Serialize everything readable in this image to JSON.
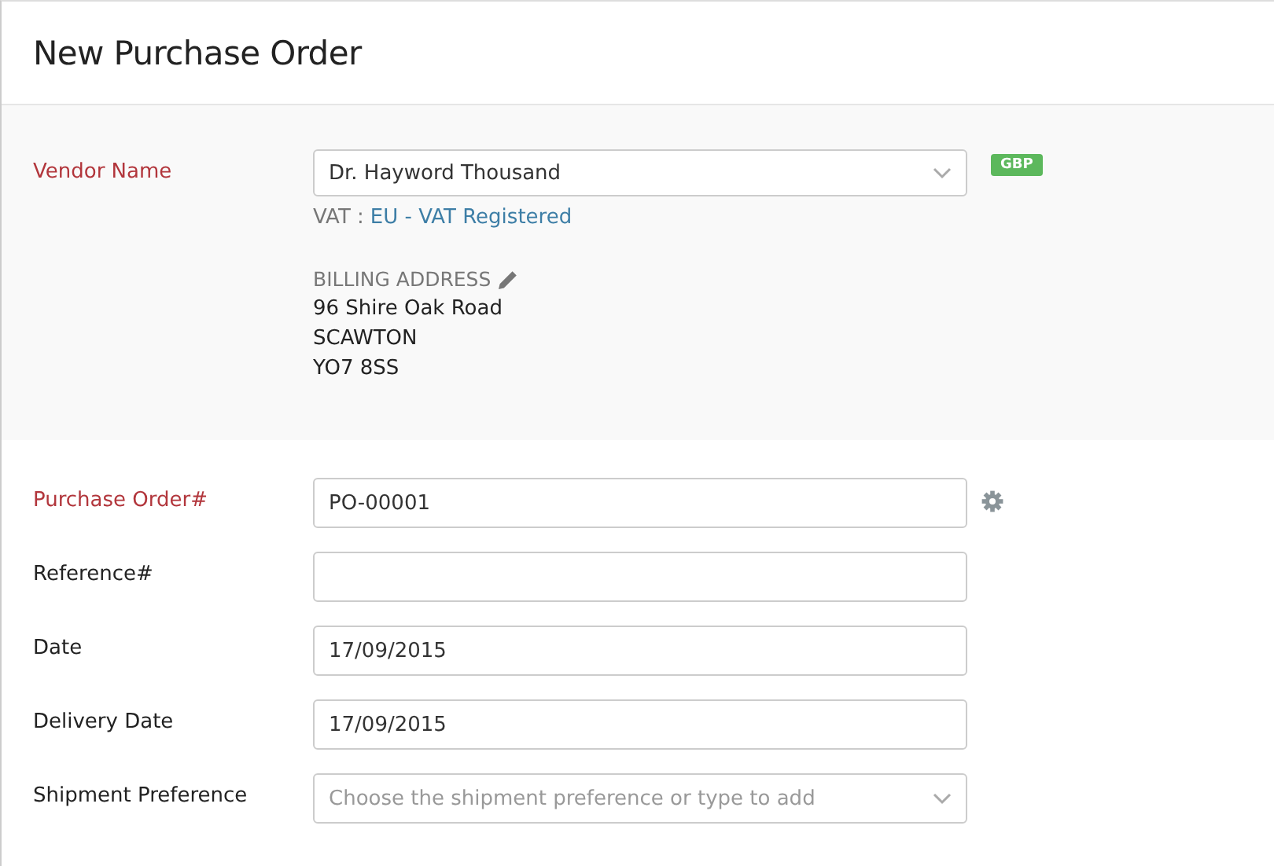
{
  "title": "New Purchase Order",
  "vendor": {
    "label": "Vendor Name",
    "required": true,
    "value": "Dr. Hayword Thousand",
    "currency": "GBP",
    "vat_label": "VAT :",
    "vat_value": "EU - VAT Registered",
    "billing_heading": "BILLING ADDRESS",
    "address_lines": [
      "96 Shire Oak Road",
      "SCAWTON",
      "YO7 8SS"
    ]
  },
  "fields": [
    {
      "label": "Purchase Order#",
      "required": true,
      "kind": "text",
      "value": "PO-00001",
      "settings": true
    },
    {
      "label": "Reference#",
      "required": false,
      "kind": "text",
      "settings": false
    },
    {
      "label": "Date",
      "required": false,
      "kind": "text",
      "value": "17/09/2015",
      "settings": false
    },
    {
      "label": "Delivery Date",
      "required": false,
      "kind": "text",
      "value": "17/09/2015",
      "settings": false
    },
    {
      "label": "Shipment Preference",
      "required": false,
      "kind": "select",
      "placeholder": "Choose the shipment preference or type to add",
      "settings": false
    }
  ]
}
